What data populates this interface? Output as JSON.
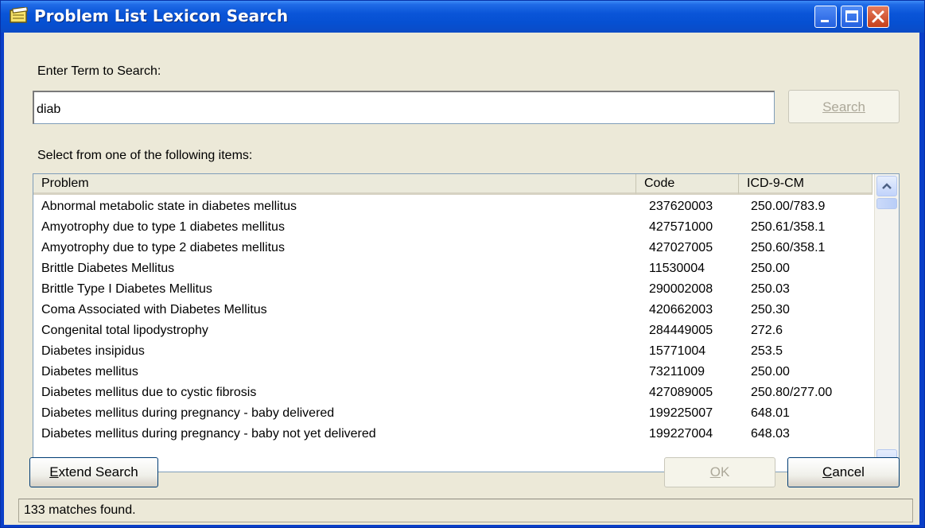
{
  "window": {
    "title": "Problem List  Lexicon Search",
    "accent": "#0a55d8"
  },
  "search": {
    "label": "Enter Term to Search:",
    "value": "diab",
    "button_label": "Search"
  },
  "list": {
    "label": "Select from one of the following items:",
    "columns": [
      "Problem",
      "Code",
      "ICD-9-CM"
    ],
    "rows": [
      [
        "Abnormal metabolic state in diabetes mellitus",
        "237620003",
        "250.00/783.9"
      ],
      [
        "Amyotrophy due to type 1 diabetes mellitus",
        "427571000",
        "250.61/358.1"
      ],
      [
        "Amyotrophy due to type 2 diabetes mellitus",
        "427027005",
        "250.60/358.1"
      ],
      [
        "Brittle Diabetes Mellitus",
        "11530004",
        "250.00"
      ],
      [
        "Brittle Type I Diabetes Mellitus",
        "290002008",
        "250.03"
      ],
      [
        "Coma Associated with Diabetes Mellitus",
        "420662003",
        "250.30"
      ],
      [
        "Congenital total lipodystrophy",
        "284449005",
        "272.6"
      ],
      [
        "Diabetes insipidus",
        "15771004",
        "253.5"
      ],
      [
        "Diabetes mellitus",
        "73211009",
        "250.00"
      ],
      [
        "Diabetes mellitus due to cystic fibrosis",
        "427089005",
        "250.80/277.00"
      ],
      [
        "Diabetes mellitus during pregnancy - baby delivered",
        "199225007",
        "648.01"
      ],
      [
        "Diabetes mellitus during pregnancy - baby not yet delivered",
        "199227004",
        "648.03"
      ]
    ]
  },
  "buttons": {
    "extend_first": "E",
    "extend_rest": "xtend Search",
    "ok_first": "O",
    "ok_rest": "K",
    "cancel_first": "C",
    "cancel_rest": "ancel"
  },
  "status": {
    "text": "133 matches found."
  },
  "icons": {
    "window": "notepad-icon",
    "minimize": "minimize-icon",
    "maximize": "maximize-icon",
    "close": "close-icon",
    "up": "chevron-up-icon",
    "down": "chevron-down-icon"
  }
}
